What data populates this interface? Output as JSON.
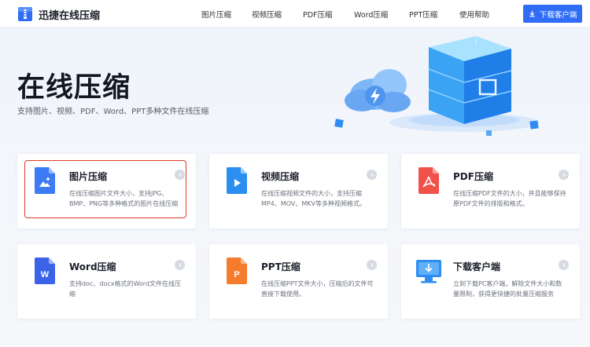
{
  "header": {
    "brand": "迅捷在线压缩",
    "nav": [
      "图片压缩",
      "视频压缩",
      "PDF压缩",
      "Word压缩",
      "PPT压缩",
      "使用帮助"
    ],
    "download_label": "下载客户端"
  },
  "hero": {
    "title": "在线压缩",
    "subtitle": "支持图片、视频、PDF、Word、PPT多种文件在线压缩"
  },
  "cards": [
    {
      "title": "图片压缩",
      "desc": "在线压缩图片文件大小，支持JPG、BMP、PNG等多种格式的图片在线压缩",
      "icon": "image-file-icon"
    },
    {
      "title": "视频压缩",
      "desc": "在线压缩视频文件的大小，支持压缩MP4、MOV、MKV等多种视频格式。",
      "icon": "video-file-icon"
    },
    {
      "title": "PDF压缩",
      "desc": "在线压缩PDF文件的大小，并且能够保持原PDF文件的排版和格式。",
      "icon": "pdf-file-icon"
    },
    {
      "title": "Word压缩",
      "desc": "支持doc、docx格式的Word文件在线压缩",
      "icon": "word-file-icon"
    },
    {
      "title": "PPT压缩",
      "desc": "在线压缩PPT文件大小，压缩后的文件可直接下载使用。",
      "icon": "ppt-file-icon"
    },
    {
      "title": "下载客户端",
      "desc": "立刻下载PC客户端，解除文件大小和数量限制，获得更快捷的批量压缩服务",
      "icon": "desktop-download-icon"
    }
  ],
  "colors": {
    "accent": "#2f6df6",
    "highlight": "#e03a2b",
    "pdf_red": "#f0524a",
    "ppt_orange": "#f57c2c",
    "word_blue": "#3a63e8"
  }
}
